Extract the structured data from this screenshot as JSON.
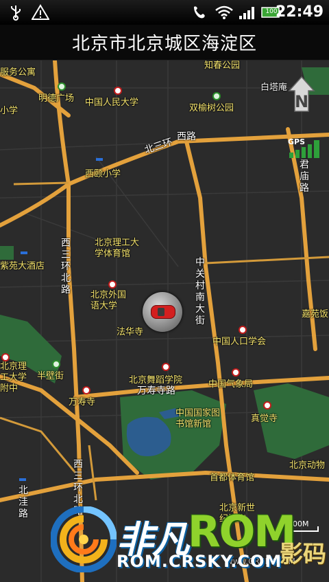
{
  "status_bar": {
    "time": "22:49",
    "battery": "100",
    "icons": [
      "usb-icon",
      "warning-icon",
      "phone-icon",
      "wifi-icon",
      "signal-icon",
      "battery-icon"
    ]
  },
  "title": "北京市北京城区海淀区",
  "map": {
    "places": [
      {
        "name": "知春公园",
        "style": "yellow"
      },
      {
        "name": "服务公寓",
        "style": "yellow"
      },
      {
        "name": "白塔庵",
        "style": "white"
      },
      {
        "name": "明德广场",
        "style": "yellow"
      },
      {
        "name": "中国人民大学",
        "style": "yellow"
      },
      {
        "name": "双榆树公园",
        "style": "yellow"
      },
      {
        "name": "小学",
        "style": "yellow"
      },
      {
        "name": "西颐小学",
        "style": "yellow"
      },
      {
        "name": "北京理工大学体育馆",
        "style": "yellow"
      },
      {
        "name": "紫苑大酒店",
        "style": "yellow"
      },
      {
        "name": "北京外国语大学",
        "style": "yellow"
      },
      {
        "name": "法华寺",
        "style": "yellow"
      },
      {
        "name": "嘉苑饭",
        "style": "yellow"
      },
      {
        "name": "中国人口学会",
        "style": "yellow"
      },
      {
        "name": "北京理工大学附中",
        "style": "yellow"
      },
      {
        "name": "半壁街",
        "style": "yellow"
      },
      {
        "name": "北京舞蹈学院",
        "style": "yellow"
      },
      {
        "name": "中国气象局",
        "style": "yellow"
      },
      {
        "name": "万寿寺路",
        "style": "white"
      },
      {
        "name": "万寿寺",
        "style": "yellow"
      },
      {
        "name": "中国国家图书馆新馆",
        "style": "yellow"
      },
      {
        "name": "真觉寺",
        "style": "yellow"
      },
      {
        "name": "北京动物",
        "style": "yellow"
      },
      {
        "name": "首都体育馆",
        "style": "yellow"
      },
      {
        "name": "北京新世纪饭店",
        "style": "yellow"
      }
    ],
    "roads": {
      "north_third_ring_1": "北三环",
      "north_third_ring_2": "西路",
      "west_third_ring_north": "西三环北路",
      "zhongguancun_south": "中关村南大街",
      "junmiao": "君庙路",
      "west_third_ring_north_2": "西三环北路",
      "beiwa": "北洼路"
    },
    "gps_label": "GPS",
    "scale_label": "500M",
    "compass_letter": "N"
  },
  "watermark": {
    "cn": "非凡",
    "rom": "ROM",
    "url": "ROM.CRSKY.COM",
    "side": "影码"
  },
  "colors": {
    "road": "#e3a13c",
    "background": "#2b2b2b",
    "park": "#2f6b3a",
    "water": "#2c5d8f",
    "label": "#f4e36d"
  }
}
